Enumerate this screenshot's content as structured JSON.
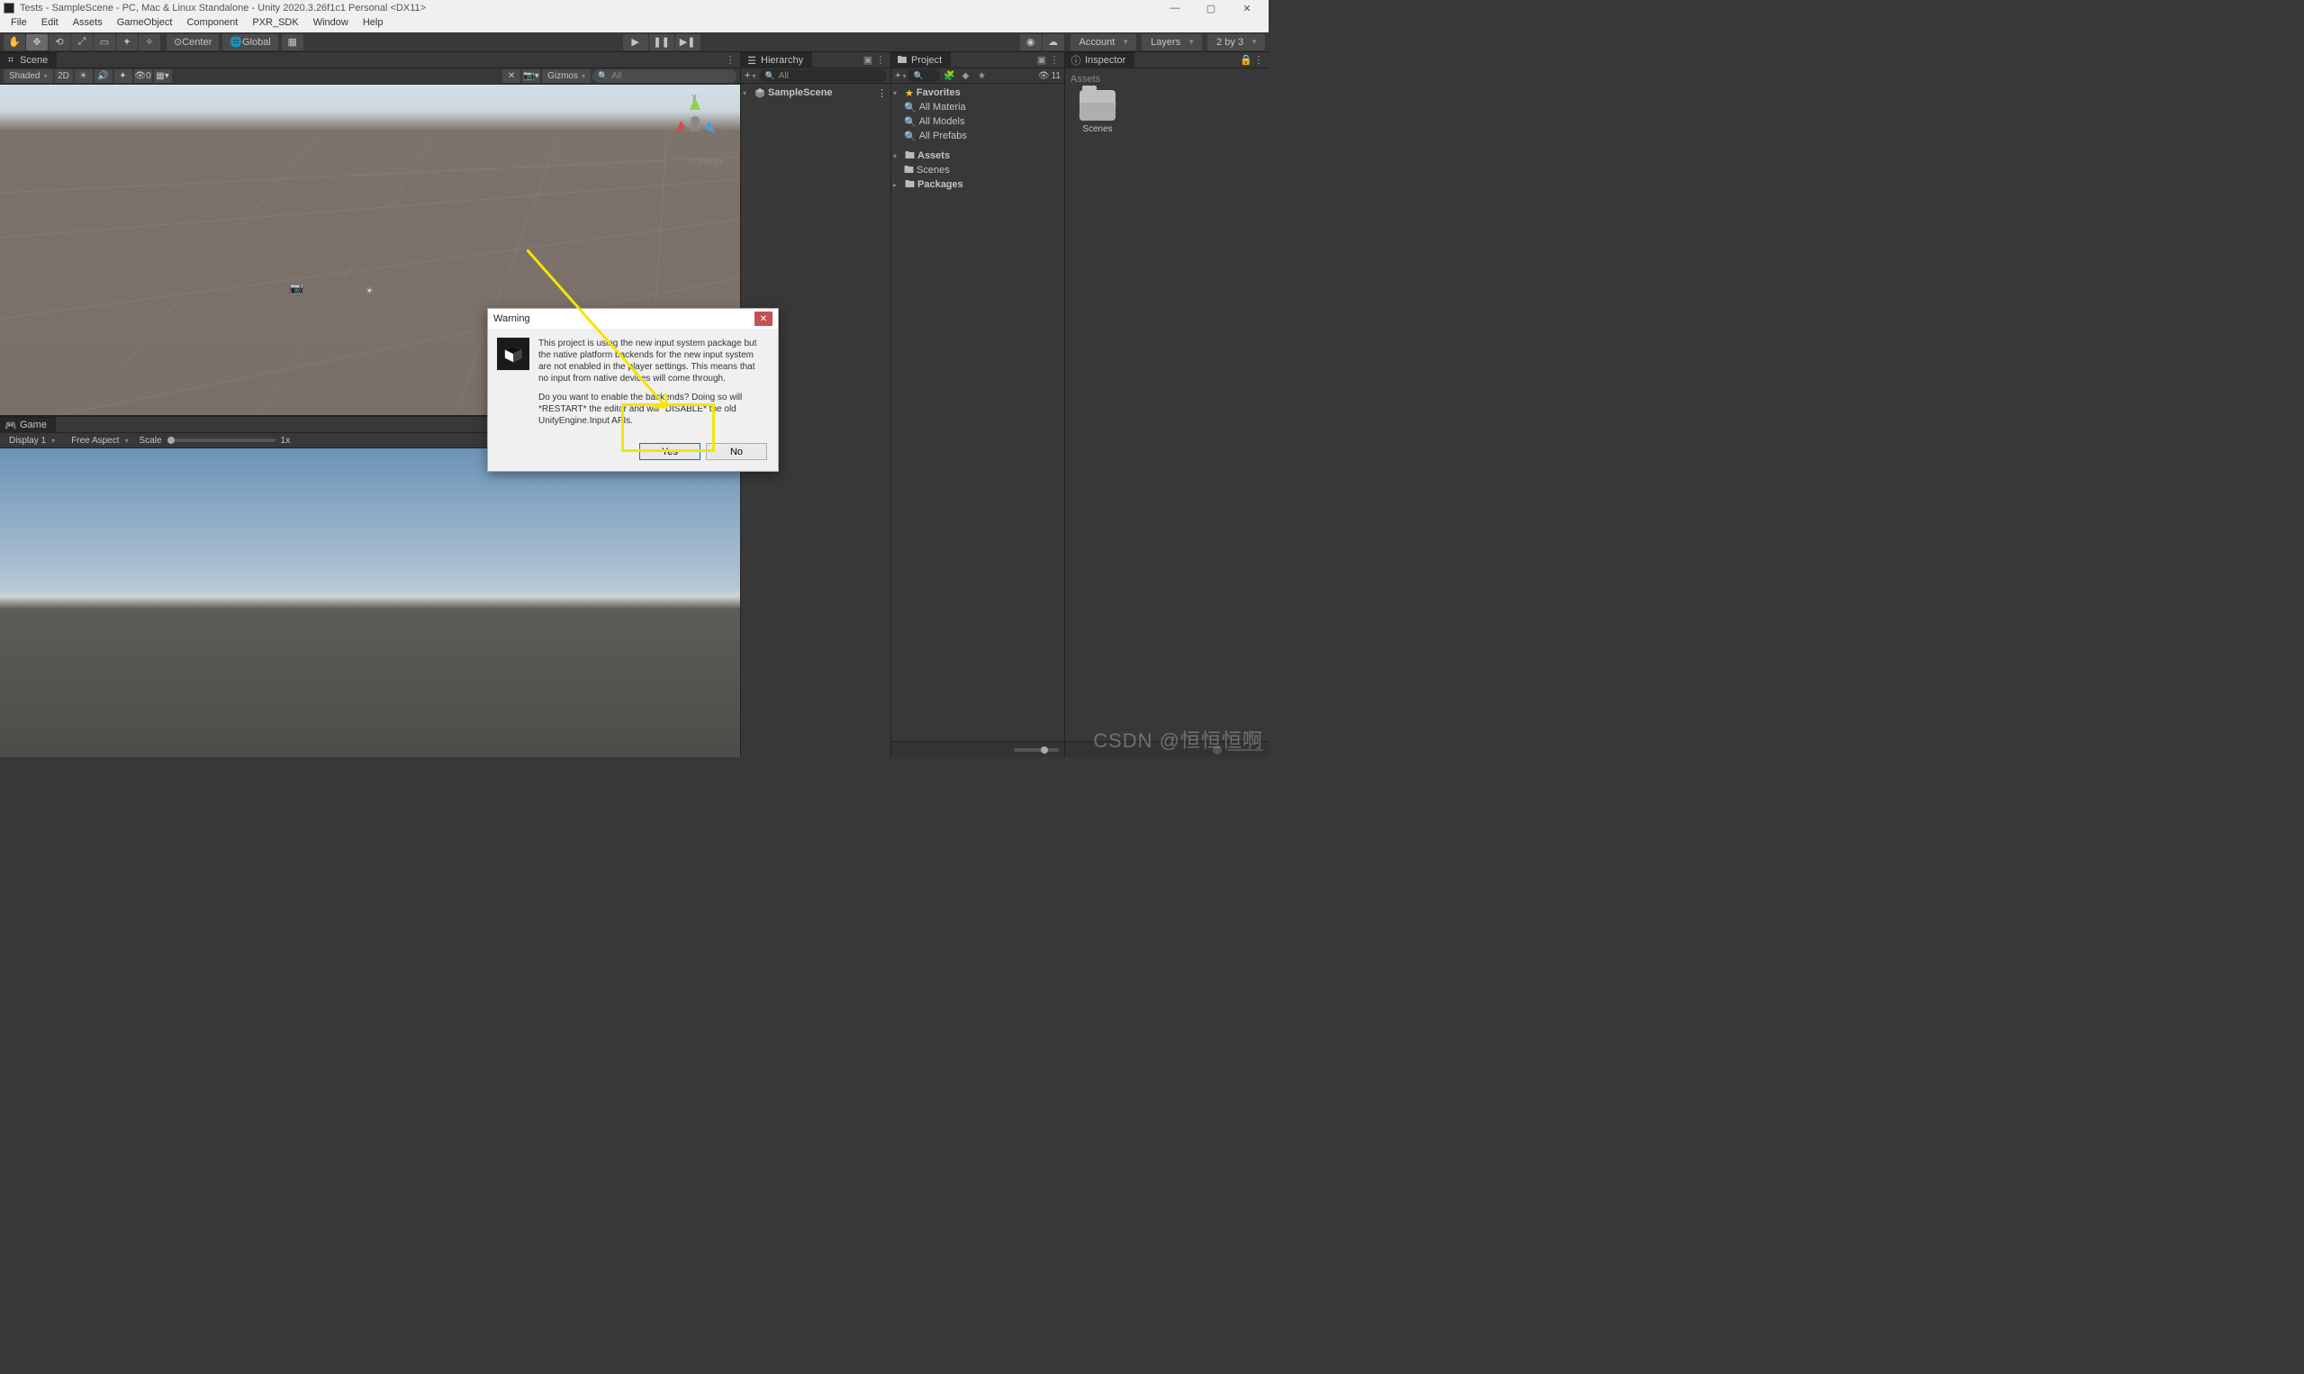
{
  "window": {
    "title": "Tests - SampleScene - PC, Mac & Linux Standalone - Unity 2020.3.26f1c1 Personal <DX11>",
    "minimize": "—",
    "maximize": "▢",
    "close": "✕"
  },
  "menu": [
    "File",
    "Edit",
    "Assets",
    "GameObject",
    "Component",
    "PXR_SDK",
    "Window",
    "Help"
  ],
  "toolbar": {
    "center": "Center",
    "global": "Global",
    "account": "Account",
    "layers": "Layers",
    "layout": "2 by 3"
  },
  "scene": {
    "tab": "Scene",
    "shading": "Shaded",
    "mode2d": "2D",
    "hidden_count": "0",
    "gizmos": "Gizmos",
    "search_placeholder": "All",
    "axis_x": "x",
    "axis_y": "y",
    "axis_z": "z",
    "persp": "Persp"
  },
  "game": {
    "tab": "Game",
    "display": "Display 1",
    "aspect": "Free Aspect",
    "scale_label": "Scale",
    "scale_value": "1x"
  },
  "hierarchy": {
    "tab": "Hierarchy",
    "search_placeholder": "All",
    "root": "SampleScene"
  },
  "project": {
    "tab": "Project",
    "hidden_count": "11",
    "favorites": "Favorites",
    "fav_items": [
      "All Materia",
      "All Models",
      "All Prefabs"
    ],
    "assets": "Assets",
    "assets_items": [
      "Scenes"
    ],
    "packages": "Packages"
  },
  "inspector": {
    "tab": "Inspector",
    "assets_crumb": "Assets",
    "folder_name": "Scenes"
  },
  "dialog": {
    "title": "Warning",
    "p1": "This project is using the new input system package but the native platform backends for the new input system are not enabled in the player settings. This means that no input from native devices will come through.",
    "p2": "Do you want to enable the backends? Doing so will *RESTART* the editor and will *DISABLE* the old UnityEngine.Input APIs.",
    "yes": "Yes",
    "no": "No"
  },
  "watermark": "CSDN @恒恒恒啊"
}
